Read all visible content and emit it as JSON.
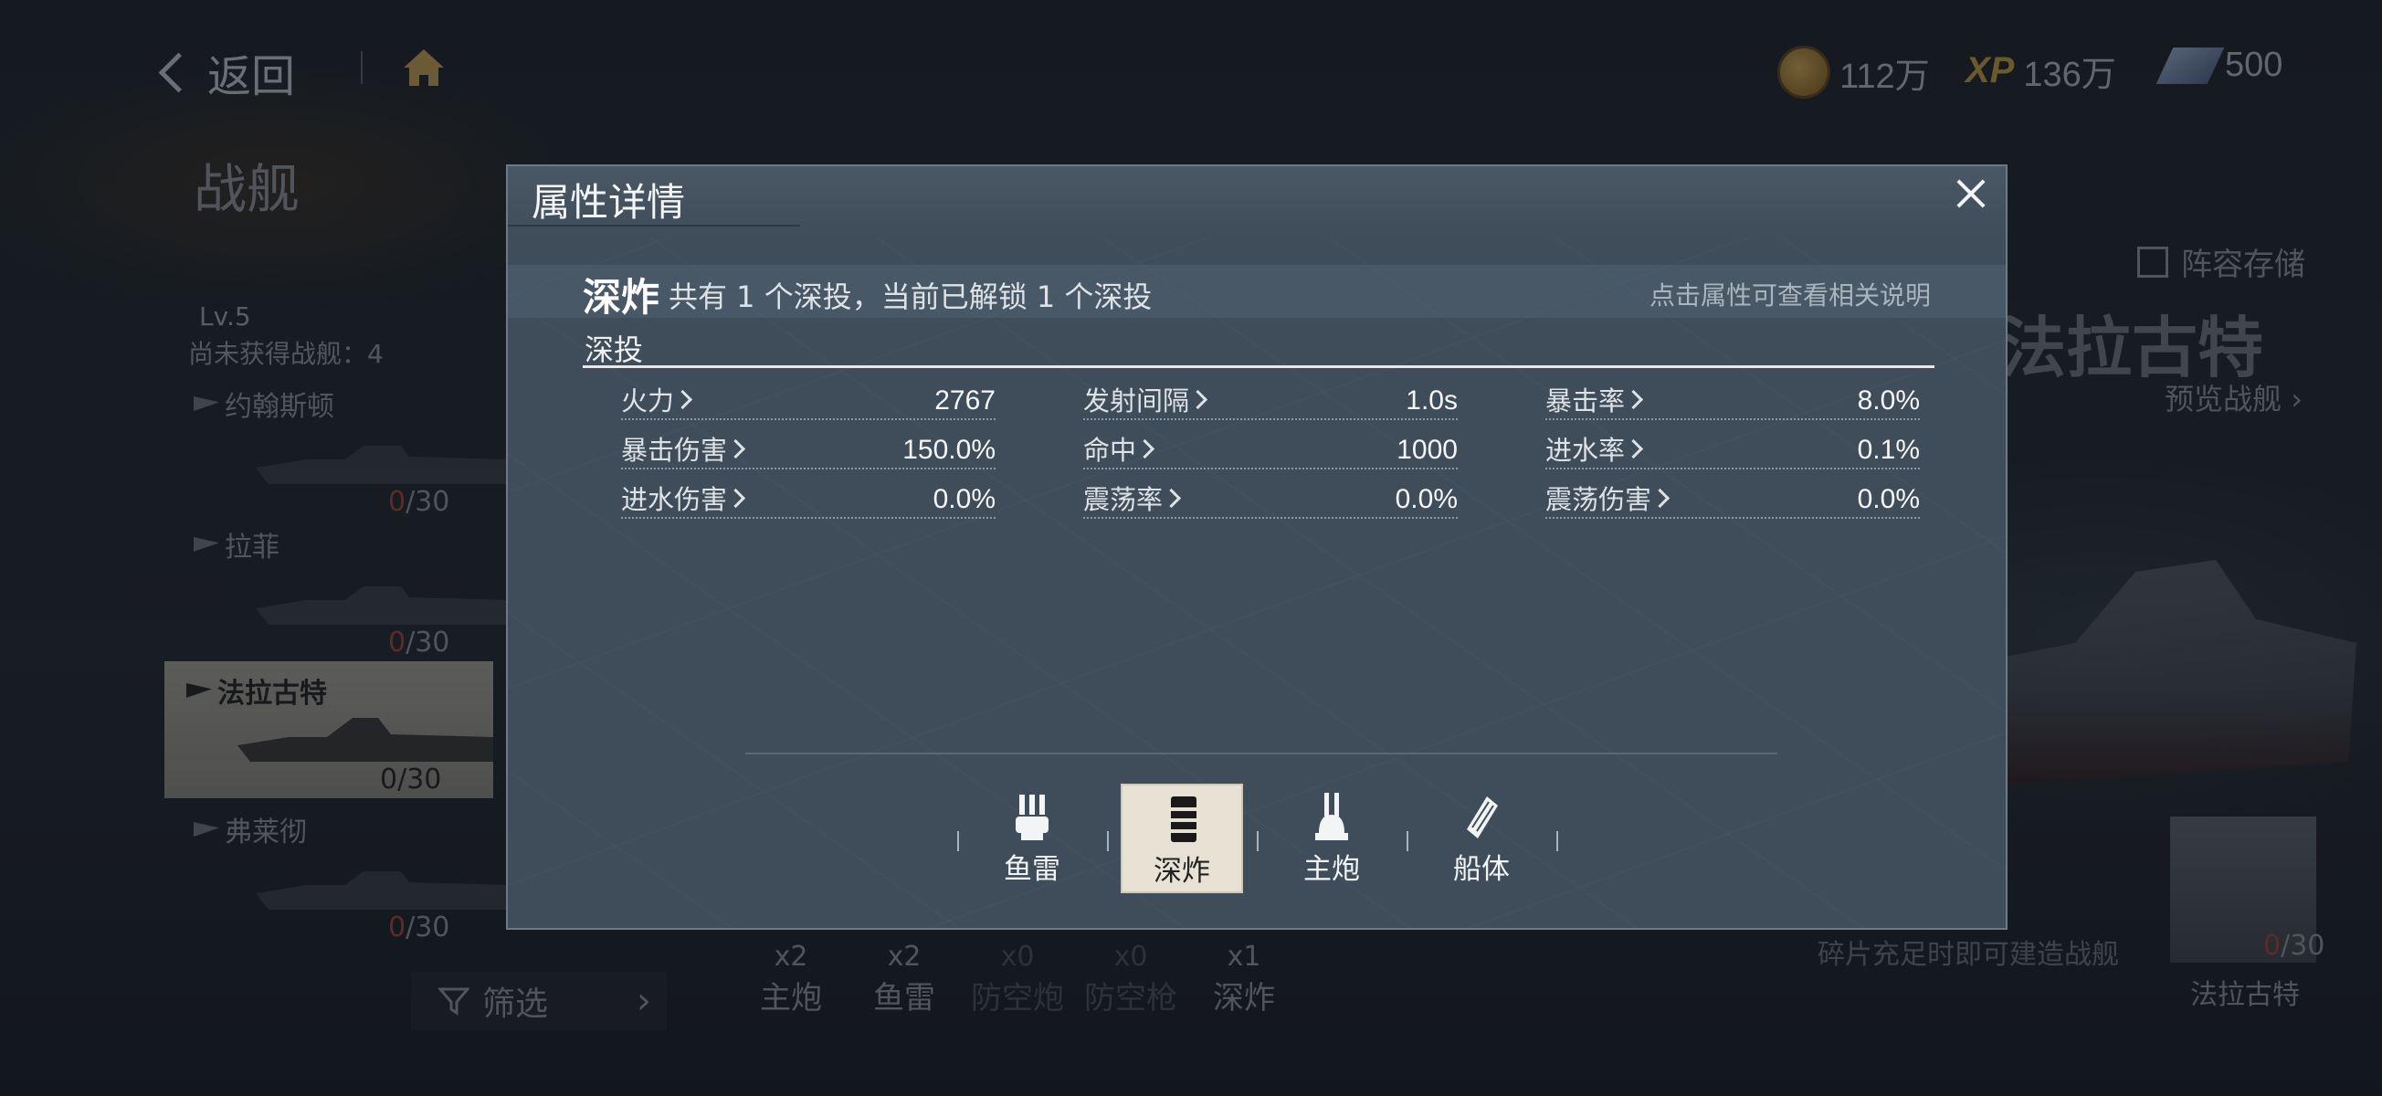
{
  "topbar": {
    "back_label": "返回",
    "resources": [
      {
        "icon": "coin-icon",
        "value": "112万"
      },
      {
        "icon": "xp-icon",
        "label": "XP",
        "value": "136万"
      },
      {
        "icon": "gem-icon",
        "value": "500"
      }
    ]
  },
  "left": {
    "title": "战舰",
    "level": "Lv.5",
    "not_obtained": "尚未获得战舰：4",
    "ships": [
      {
        "name": "约翰斯顿",
        "count_have": "0",
        "count_total": "/30"
      },
      {
        "name": "拉菲",
        "count_have": "0",
        "count_total": "/30"
      },
      {
        "name": "法拉古特",
        "count_have": "0",
        "count_total": "/30"
      },
      {
        "name": "弗莱彻",
        "count_have": "0",
        "count_total": "/30"
      }
    ],
    "filter_label": "筛选"
  },
  "bottom_weapons": [
    {
      "count": "x2",
      "label": "主炮",
      "icon": "main-gun-icon"
    },
    {
      "count": "x2",
      "label": "鱼雷",
      "icon": "torpedo-icon"
    },
    {
      "count": "x0",
      "label": "防空炮",
      "icon": "aa-gun-icon"
    },
    {
      "count": "x0",
      "label": "防空枪",
      "icon": "aa-mg-icon"
    },
    {
      "count": "x1",
      "label": "深炸",
      "icon": "depth-charge-icon"
    }
  ],
  "right": {
    "save_label": "阵容存储",
    "ship_name": "法拉古特",
    "preview_label": "预览战舰",
    "build_tip": "碎片充足时即可建造战舰",
    "card_count_have": "0",
    "card_count_total": "/30",
    "card_name": "法拉古特"
  },
  "modal": {
    "title": "属性详情",
    "section_name": "深炸",
    "section_desc": "共有 1 个深投，当前已解锁 1 个深投",
    "hint": "点击属性可查看相关说明",
    "sub_title": "深投",
    "stats": [
      {
        "key": "火力",
        "value": "2767"
      },
      {
        "key": "发射间隔",
        "value": "1.0s"
      },
      {
        "key": "暴击率",
        "value": "8.0%"
      },
      {
        "key": "暴击伤害",
        "value": "150.0%"
      },
      {
        "key": "命中",
        "value": "1000"
      },
      {
        "key": "进水率",
        "value": "0.1%"
      },
      {
        "key": "进水伤害",
        "value": "0.0%"
      },
      {
        "key": "震荡率",
        "value": "0.0%"
      },
      {
        "key": "震荡伤害",
        "value": "0.0%"
      }
    ],
    "tabs": [
      {
        "label": "鱼雷",
        "icon": "torpedo-icon",
        "active": false
      },
      {
        "label": "深炸",
        "icon": "depth-charge-icon",
        "active": true
      },
      {
        "label": "主炮",
        "icon": "main-gun-icon",
        "active": false
      },
      {
        "label": "船体",
        "icon": "hull-icon",
        "active": false
      }
    ]
  }
}
